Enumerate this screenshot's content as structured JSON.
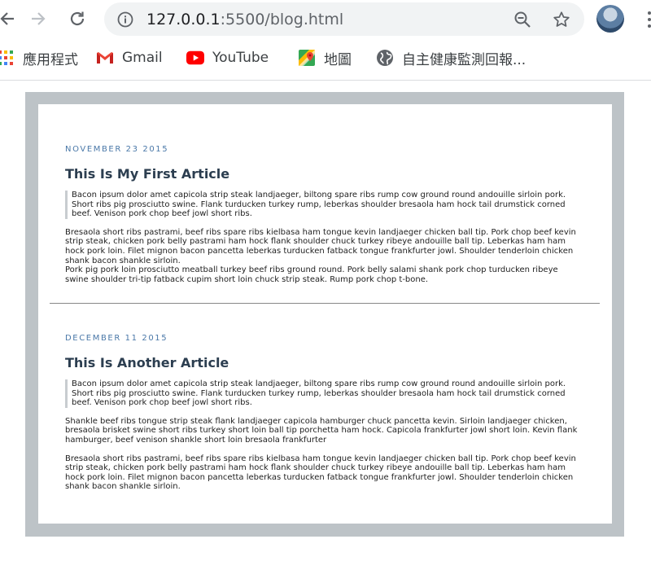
{
  "browser": {
    "url_host": "127.0.0.1",
    "url_rest": ":5500/blog.html",
    "icons": [
      "back-arrow-icon",
      "forward-arrow-icon",
      "reload-icon",
      "info-icon",
      "zoom-out-icon",
      "star-icon",
      "profile-avatar",
      "more-menu-icon"
    ]
  },
  "bookmarks": [
    {
      "label": "應用程式",
      "icon": "apps-grid-icon"
    },
    {
      "label": "Gmail",
      "icon": "gmail-icon"
    },
    {
      "label": "YouTube",
      "icon": "youtube-icon"
    },
    {
      "label": "地圖",
      "icon": "maps-icon"
    },
    {
      "label": "自主健康監測回報...",
      "icon": "globe-icon"
    }
  ],
  "articles": [
    {
      "date": "NOVEMBER 23 2015",
      "title": "This Is My First Article",
      "quote": "Bacon ipsum dolor amet capicola strip steak landjaeger, biltong spare ribs rump cow ground round andouille sirloin pork. Short ribs pig prosciutto swine. Flank turducken turkey rump, leberkas shoulder bresaola ham hock tail drumstick corned beef. Venison pork chop beef jowl short ribs.",
      "paragraphs": [
        "Bresaola short ribs pastrami, beef ribs spare ribs kielbasa ham tongue kevin landjaeger chicken ball tip. Pork chop beef kevin strip steak, chicken pork belly pastrami ham hock flank shoulder chuck turkey ribeye andouille ball tip. Leberkas ham ham hock pork loin. Filet mignon bacon pancetta leberkas turducken fatback tongue frankfurter jowl. Shoulder tenderloin chicken shank bacon shankle sirloin.",
        "Pork pig pork loin prosciutto meatball turkey beef ribs ground round. Pork belly salami shank pork chop turducken ribeye swine shoulder tri-tip fatback cupim short loin chuck strip steak. Rump pork chop t-bone."
      ]
    },
    {
      "date": "DECEMBER 11 2015",
      "title": "This Is Another Article",
      "quote": "Bacon ipsum dolor amet capicola strip steak landjaeger, biltong spare ribs rump cow ground round andouille sirloin pork. Short ribs pig prosciutto swine. Flank turducken turkey rump, leberkas shoulder bresaola ham hock tail drumstick corned beef. Venison pork chop beef jowl short ribs.",
      "paragraphs": [
        "Shankle beef ribs tongue strip steak flank landjaeger capicola hamburger chuck pancetta kevin. Sirloin landjaeger chicken, bresaola brisket swine short ribs turkey short loin ball tip porchetta ham hock. Capicola frankfurter jowl short loin. Kevin flank hamburger, beef venison shankle short loin bresaola frankfurter",
        "Bresaola short ribs pastrami, beef ribs spare ribs kielbasa ham tongue kevin landjaeger chicken ball tip. Pork chop beef kevin strip steak, chicken pork belly pastrami ham hock flank shoulder chuck turkey ribeye andouille ball tip. Leberkas ham ham hock pork loin. Filet mignon bacon pancetta leberkas turducken fatback tongue frankfurter jowl. Shoulder tenderloin chicken shank bacon shankle sirloin."
      ]
    }
  ],
  "colors": {
    "frame": "#bdc3c7",
    "date": "#4a78a8",
    "title": "#2c3e50"
  }
}
